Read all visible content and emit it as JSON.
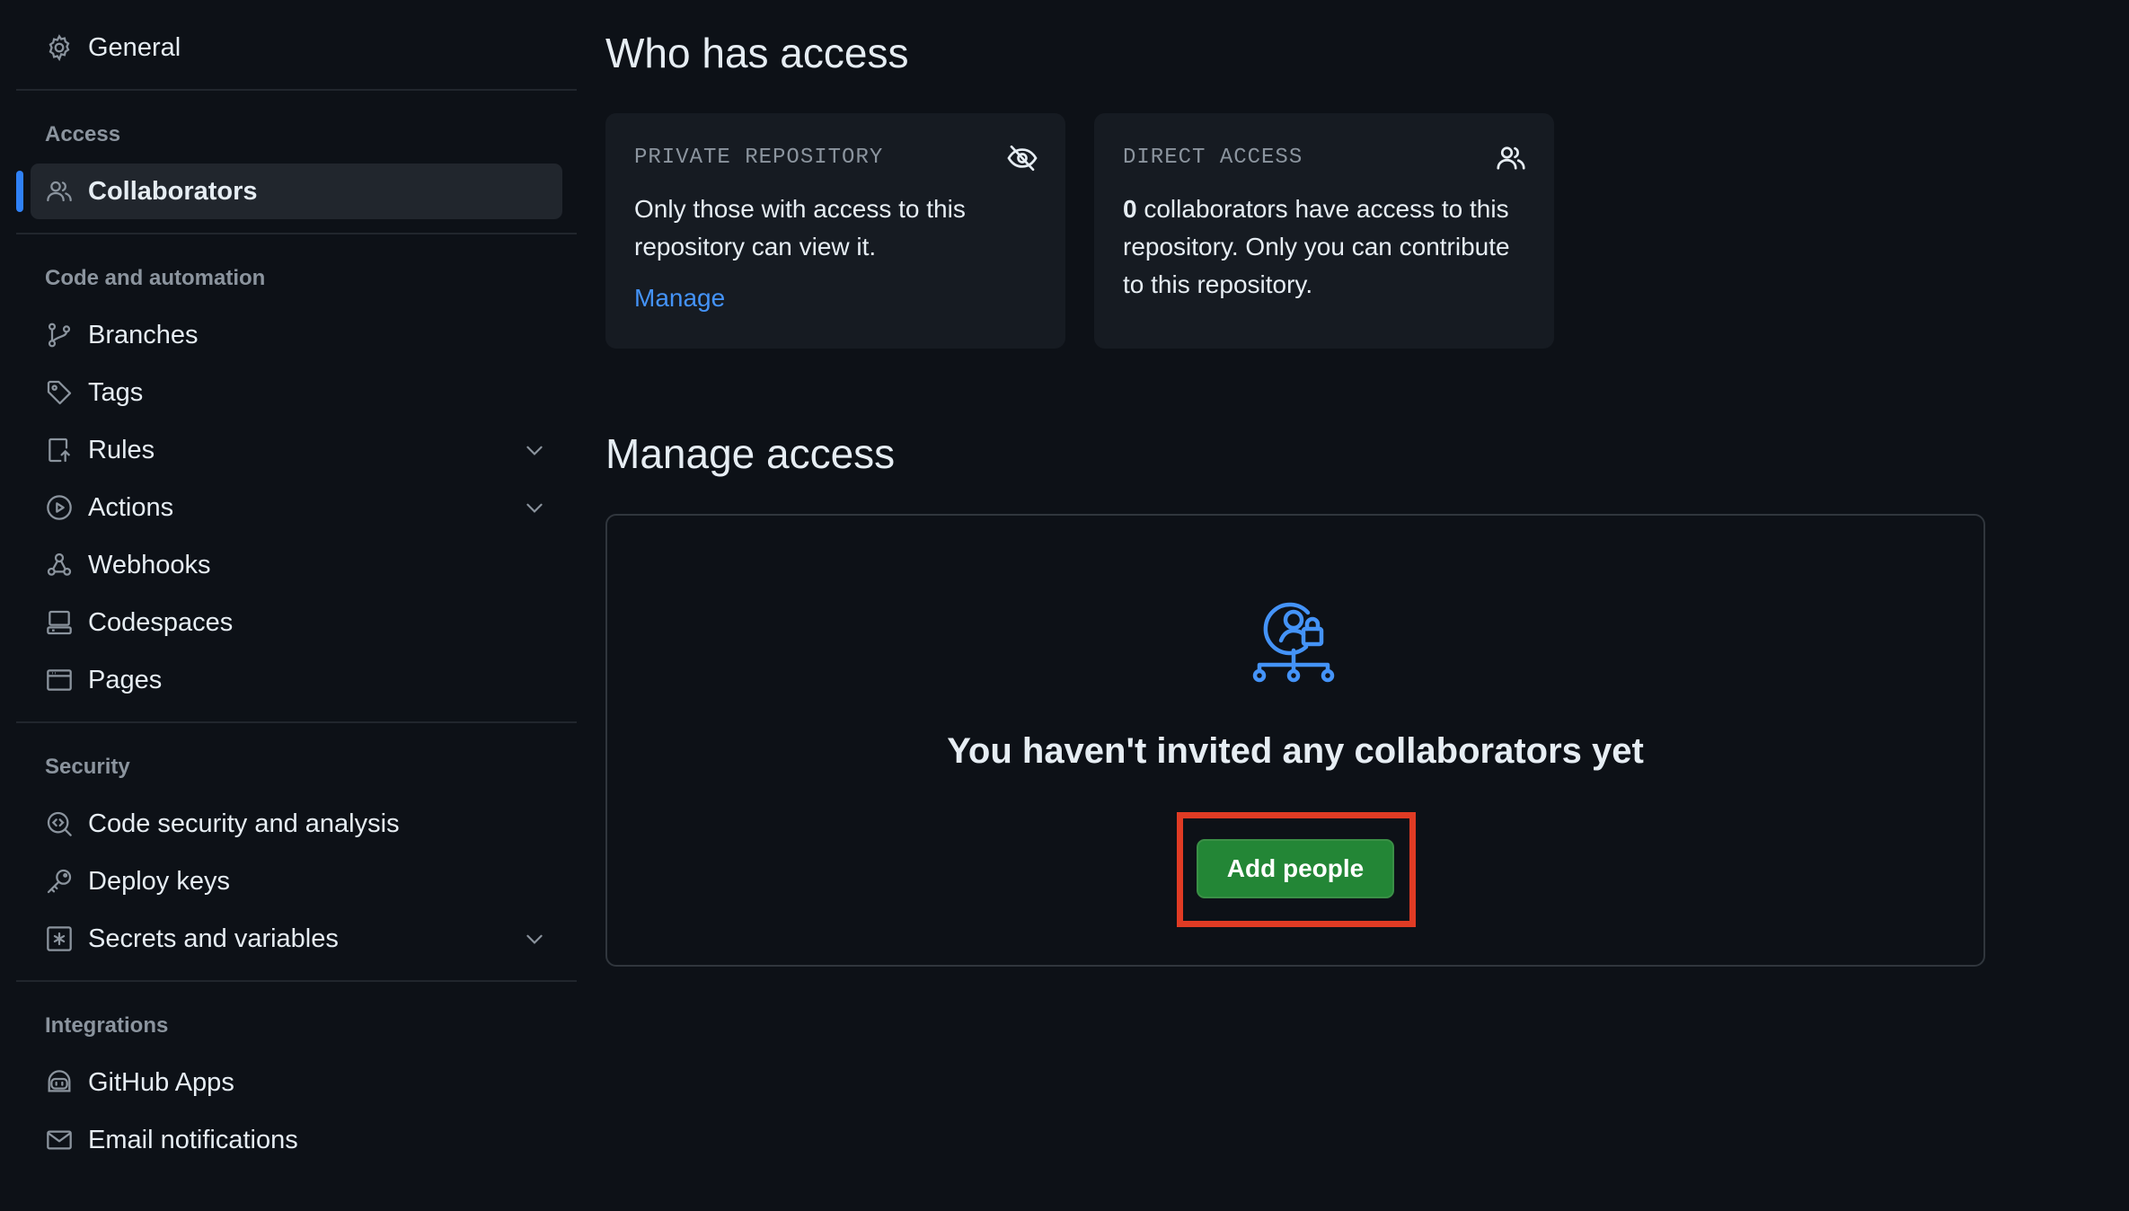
{
  "sidebar": {
    "general": {
      "label": "General",
      "icon": "gear-icon"
    },
    "sections": {
      "access": "Access",
      "code_automation": "Code and automation",
      "security": "Security",
      "integrations": "Integrations"
    },
    "items": {
      "collaborators": {
        "label": "Collaborators",
        "icon": "people-icon",
        "active": true
      },
      "branches": {
        "label": "Branches",
        "icon": "branch-icon"
      },
      "tags": {
        "label": "Tags",
        "icon": "tag-icon"
      },
      "rules": {
        "label": "Rules",
        "icon": "rules-icon",
        "expandable": true
      },
      "actions": {
        "label": "Actions",
        "icon": "play-circle-icon",
        "expandable": true
      },
      "webhooks": {
        "label": "Webhooks",
        "icon": "webhook-icon"
      },
      "codespaces": {
        "label": "Codespaces",
        "icon": "codespaces-icon"
      },
      "pages": {
        "label": "Pages",
        "icon": "browser-icon"
      },
      "code_security": {
        "label": "Code security and analysis",
        "icon": "codescan-icon"
      },
      "deploy_keys": {
        "label": "Deploy keys",
        "icon": "key-icon"
      },
      "secrets": {
        "label": "Secrets and variables",
        "icon": "asterisk-icon",
        "expandable": true
      },
      "github_apps": {
        "label": "GitHub Apps",
        "icon": "apps-icon"
      },
      "email": {
        "label": "Email notifications",
        "icon": "mail-icon"
      }
    }
  },
  "main": {
    "who_has_access_title": "Who has access",
    "private_card": {
      "title": "PRIVATE REPOSITORY",
      "text": "Only those with access to this repository can view it.",
      "link": "Manage",
      "icon": "eye-closed-icon"
    },
    "direct_card": {
      "title": "DIRECT ACCESS",
      "count": "0",
      "text": " collaborators have access to this repository. Only you can contribute to this repository.",
      "icon": "people-icon"
    },
    "manage_access_title": "Manage access",
    "empty_state": {
      "title": "You haven't invited any collaborators yet",
      "button": "Add people",
      "icon": "person-lock-network-icon"
    }
  },
  "colors": {
    "background": "#0d1117",
    "accent": "#2f81f7",
    "button_green": "#238636",
    "highlight": "#e03b24"
  }
}
